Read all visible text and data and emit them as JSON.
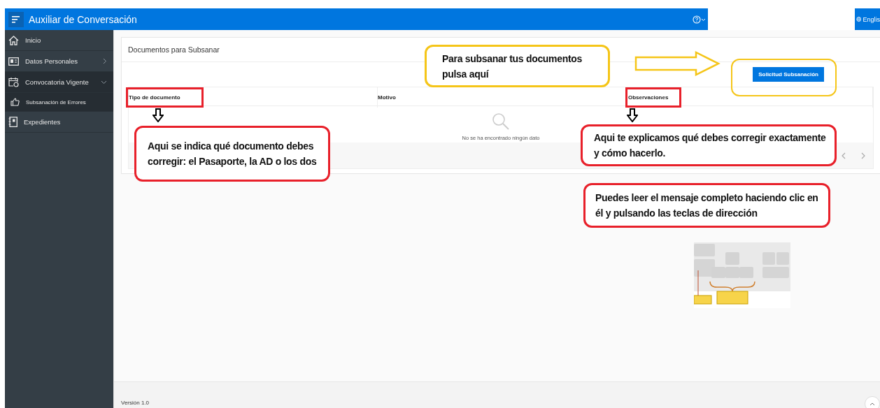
{
  "header": {
    "title": "Auxiliar de Conversación",
    "language": "Englis"
  },
  "sidebar": {
    "items": [
      {
        "label": "Inicio",
        "kind": "link"
      },
      {
        "label": "Datos Personales",
        "kind": "group",
        "expanded": false
      },
      {
        "label": "Convocatoria Vigente",
        "kind": "group",
        "expanded": true,
        "children": [
          {
            "label": "Subsanación de Errores"
          }
        ]
      },
      {
        "label": "Expedientes",
        "kind": "link"
      }
    ]
  },
  "card": {
    "title": "Documentos para Subsanar",
    "button": "Solicitud Subsanación",
    "columns": [
      {
        "label": "Tipo de documento",
        "highlighted": true
      },
      {
        "label": "Motivo",
        "highlighted": false
      },
      {
        "label": "Observaciones",
        "highlighted": true
      }
    ],
    "empty_message": "No se ha encontrado ningún dato"
  },
  "callouts": [
    {
      "text": "Para subsanar tus documentos pulsa aquí",
      "color": "#f5c518"
    },
    {
      "text": "Aqui se indica qué documento debes corregir: el Pasaporte, la AD o los dos",
      "color": "#e8202a"
    },
    {
      "text": "Aqui te explicamos qué debes corregir exactamente y cómo hacerlo.",
      "color": "#e8202a"
    },
    {
      "text": "Puedes leer el mensaje completo haciendo clic en él y pulsando las teclas de dirección",
      "color": "#e8202a"
    }
  ],
  "footer": {
    "version": "Versión 1.0"
  }
}
